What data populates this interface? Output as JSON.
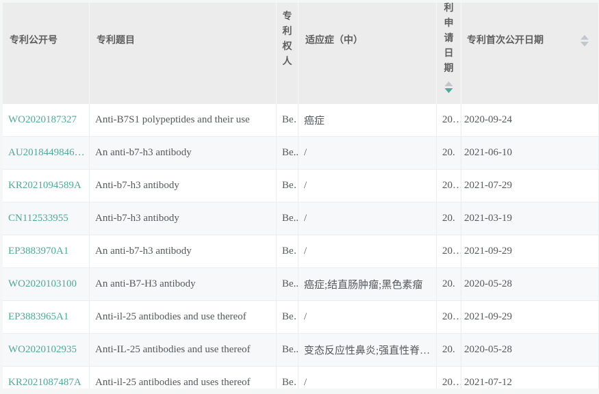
{
  "table": {
    "colors": {
      "accent": "#4fa89a",
      "sort_inactive": "#c3c7cd",
      "header_bg": "#ececec",
      "header_text": "#5e5e5e",
      "stripe_bg": "#f6f8fa",
      "body_text": "#55585c"
    },
    "columns": [
      {
        "key": "pub_number",
        "label": "专利公开号",
        "vertical": false,
        "sortable": false
      },
      {
        "key": "title",
        "label": "专利题目",
        "vertical": false,
        "sortable": false
      },
      {
        "key": "assignee",
        "label": "专利权人",
        "vertical": true,
        "sortable": false
      },
      {
        "key": "indication",
        "label": "适应症（中）",
        "vertical": false,
        "sortable": false
      },
      {
        "key": "app_date",
        "label": "专利申请日期",
        "vertical": true,
        "sortable": true,
        "sort": "desc"
      },
      {
        "key": "first_pub_date",
        "label": "专利首次公开日期",
        "vertical": false,
        "sortable": true,
        "sort": "none"
      }
    ],
    "rows": [
      {
        "pub_number": "WO2020187327",
        "title": "Anti-B7S1 polypeptides and their use",
        "assignee": "Be…",
        "indication": "癌症",
        "app_date": "20…",
        "first_pub_date": "2020-09-24"
      },
      {
        "pub_number": "AU2018449846…",
        "title": "An anti-b7-h3 antibody",
        "assignee": "Be..",
        "indication": "/",
        "app_date": "20.",
        "first_pub_date": "2021-06-10"
      },
      {
        "pub_number": "KR2021094589A",
        "title": "Anti-b7-h3 antibody",
        "assignee": "Be…",
        "indication": "/",
        "app_date": "20…",
        "first_pub_date": "2021-07-29"
      },
      {
        "pub_number": "CN112533955",
        "title": "Anti-b7-h3 antibody",
        "assignee": "Be..",
        "indication": "/",
        "app_date": "20.",
        "first_pub_date": "2021-03-19"
      },
      {
        "pub_number": "EP3883970A1",
        "title": "An anti-b7-h3 antibody",
        "assignee": "Be…",
        "indication": "/",
        "app_date": "20…",
        "first_pub_date": "2021-09-29"
      },
      {
        "pub_number": "WO2020103100",
        "title": "An anti-B7-H3 antibody",
        "assignee": "Be..",
        "indication": "癌症;结直肠肿瘤;黑色素瘤",
        "app_date": "20.",
        "first_pub_date": "2020-05-28"
      },
      {
        "pub_number": "EP3883965A1",
        "title": "Anti-il-25 antibodies and use thereof",
        "assignee": "Be…",
        "indication": "/",
        "app_date": "20…",
        "first_pub_date": "2021-09-29"
      },
      {
        "pub_number": "WO2020102935",
        "title": "Anti-IL-25 antibodies and use thereof",
        "assignee": "Be..",
        "indication": "变态反应性鼻炎;强直性脊…",
        "app_date": "20.",
        "first_pub_date": "2020-05-28"
      },
      {
        "pub_number": "KR2021087487A",
        "title": "Anti-il-25 antibodies and uses thereof",
        "assignee": "Be…",
        "indication": "/",
        "app_date": "20…",
        "first_pub_date": "2021-07-12"
      }
    ]
  }
}
